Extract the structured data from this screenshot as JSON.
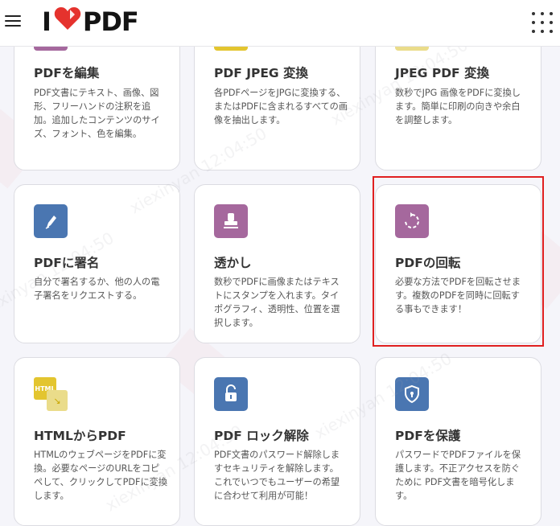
{
  "header": {
    "logo_prefix": "I",
    "logo_suffix": "PDF",
    "colors": {
      "logo_heart": "#e5322d"
    }
  },
  "cards_row1": [
    {
      "title": "PDFを編集",
      "desc": "PDF文書にテキスト、画像、図形、フリーハンドの注釈を追加。追加したコンテンツのサイズ、フォント、色を編集。",
      "icon": "edit-pdf-icon",
      "color": "#a5689d"
    },
    {
      "title": "PDF JPEG 変換",
      "desc": "各PDFページをJPGに変換する、またはPDFに含まれるすべての画像を抽出します。",
      "icon": "pdf-to-jpg-icon",
      "color": "#e3c52f"
    },
    {
      "title": "JPEG PDF 変換",
      "desc": "数秒でJPG 画像をPDFに変換します。簡単に印刷の向きや余白を調整します。",
      "icon": "jpg-to-pdf-icon",
      "color": "#eadc8a"
    }
  ],
  "cards_row2": [
    {
      "title": "PDFに署名",
      "desc": "自分で署名するか、他の人の電子署名をリクエストする。",
      "icon": "sign-pen-icon",
      "color": "#4a76b1"
    },
    {
      "title": "透かし",
      "desc": "数秒でPDFに画像またはテキストにスタンプを入れます。タイポグラフィ、透明性、位置を選択します。",
      "icon": "stamp-icon",
      "color": "#a5689d"
    },
    {
      "title": "PDFの回転",
      "desc": "必要な方法でPDFを回転させます。複数のPDFを同時に回転する事もできます！",
      "icon": "rotate-icon",
      "color": "#a5689d"
    }
  ],
  "cards_row3": [
    {
      "title": "HTMLからPDF",
      "desc": "HTMLのウェブページをPDFに変換。必要なページのURLをコピペして、クリックしてPDFに変換します。",
      "icon": "html-to-pdf-icon",
      "color": "#e3c52f",
      "badge": "HTML"
    },
    {
      "title": "PDF ロック解除",
      "desc": "PDF文書のパスワード解除しますセキュリティを解除します。これでいつでもユーザーの希望に合わせて利用が可能！",
      "icon": "unlock-icon",
      "color": "#4a76b1"
    },
    {
      "title": "PDFを保護",
      "desc": "パスワードでPDFファイルを保護します。不正アクセスを防ぐために PDF文書を暗号化します。",
      "icon": "shield-icon",
      "color": "#4a76b1"
    }
  ],
  "highlight_color": "#e02020",
  "watermark_text": "xiexinyan  12:04:50"
}
